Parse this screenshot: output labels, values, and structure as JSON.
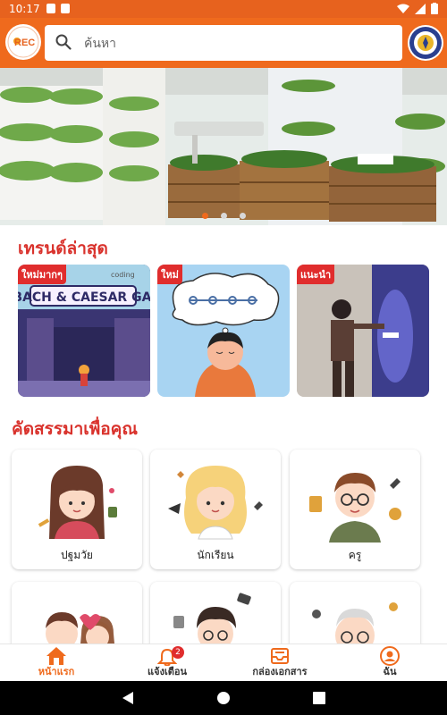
{
  "status": {
    "time": "10:17"
  },
  "search": {
    "placeholder": "ค้นหา"
  },
  "logo": {
    "text": "REC"
  },
  "banner": {
    "slides": 3,
    "active_slide": 1
  },
  "trending": {
    "title": "เทรนด์ล่าสุด",
    "items": [
      {
        "badge": "ใหม่มากๆ",
        "title": "ATBACH & CAESAR GAME",
        "caption": "coding"
      },
      {
        "badge": "ใหม่"
      },
      {
        "badge": "แนะนำ"
      }
    ]
  },
  "picks": {
    "title": "คัดสรรมาเพื่อคุณ",
    "categories": [
      {
        "label": "ปฐมวัย"
      },
      {
        "label": "นักเรียน"
      },
      {
        "label": "ครู"
      }
    ]
  },
  "bottom_nav": {
    "items": [
      {
        "label": "หน้าแรก",
        "icon": "home-icon"
      },
      {
        "label": "แจ้งเตือน",
        "icon": "bell-icon",
        "badge": "2"
      },
      {
        "label": "กล่องเอกสาร",
        "icon": "inbox-icon"
      },
      {
        "label": "ฉัน",
        "icon": "user-icon"
      }
    ]
  },
  "colors": {
    "primary": "#ef6a1d",
    "accent_red": "#d9322c",
    "badge_red": "#e02d2d"
  }
}
